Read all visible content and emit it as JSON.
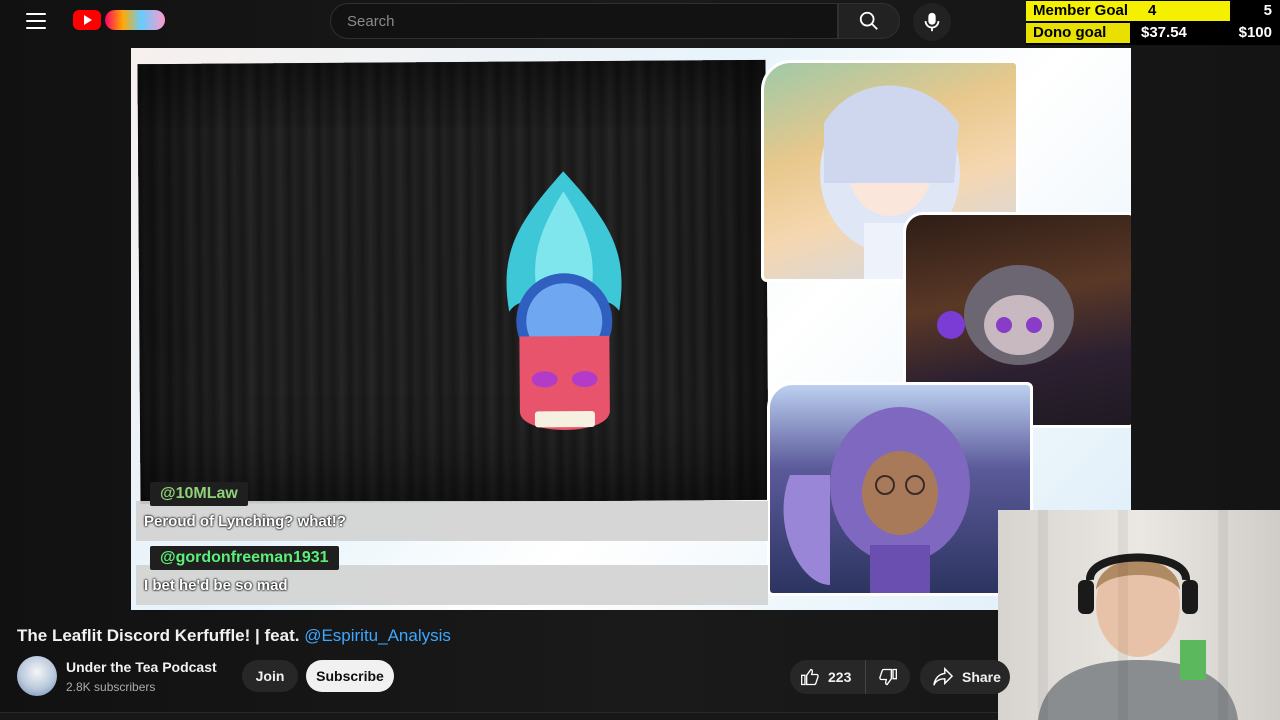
{
  "header": {
    "search_placeholder": "Search"
  },
  "goals": {
    "member": {
      "label": "Member Goal",
      "current": "4",
      "max": "5",
      "progress": 0.8
    },
    "dono": {
      "label": "Dono goal",
      "current": "$37.54",
      "max": "$100",
      "progress": 0.3754
    }
  },
  "chat": [
    {
      "user": "@10MLaw",
      "message": "Peroud of Lynching? what!?"
    },
    {
      "user": "@gordonfreeman1931",
      "message": "I bet he'd be so mad"
    }
  ],
  "video": {
    "title": "The Leaflit Discord Kerfuffle! | feat. ",
    "title_mention": "@Espiritu_Analysis"
  },
  "channel": {
    "name": "Under the Tea Podcast",
    "subscribers": "2.8K subscribers",
    "join_label": "Join",
    "subscribe_label": "Subscribe"
  },
  "actions": {
    "like_count": "223",
    "share_label": "Share"
  },
  "colors": {
    "accent_link": "#3ea6ff",
    "goal_fill": "#f5f000",
    "brand_red": "#ff0000"
  }
}
